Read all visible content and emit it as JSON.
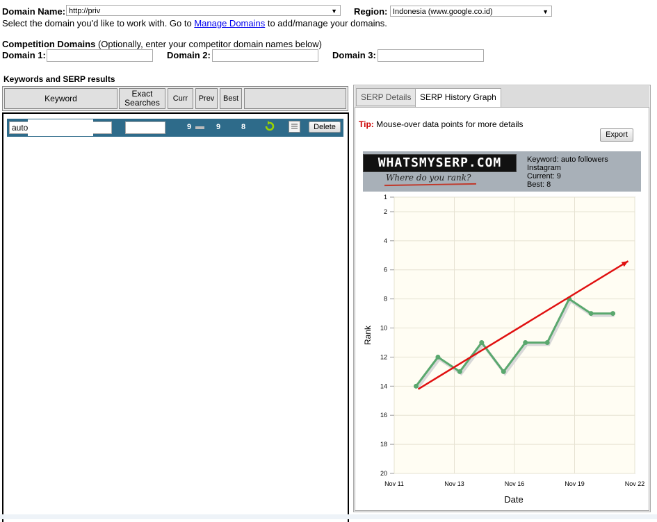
{
  "header": {
    "domain_label": "Domain Name:",
    "domain_value": "http://priv",
    "region_label": "Region:",
    "region_value": "Indonesia (www.google.co.id)",
    "instruction_before": "Select the domain you'd like to work with. Go to ",
    "instruction_link": "Manage Domains",
    "instruction_after": " to add/manage your domains."
  },
  "competition": {
    "title": "Competition Domains",
    "note": " (Optionally, enter your competitor domain names below)",
    "domain1_label": "Domain 1:",
    "domain2_label": "Domain 2:",
    "domain3_label": "Domain 3:"
  },
  "keywords": {
    "section_title": "Keywords and SERP results",
    "columns": {
      "keyword": "Keyword",
      "exact_line1": "Exact",
      "exact_line2": "Searches",
      "curr": "Curr",
      "prev": "Prev",
      "best": "Best"
    },
    "row": {
      "keyword_value": "auto",
      "curr": "9",
      "prev": "9",
      "best": "8",
      "delete_label": "Delete"
    }
  },
  "serp_panel": {
    "tabs": [
      "SERP Details",
      "SERP History Graph"
    ],
    "active_tab": "SERP History Graph",
    "tip_label": "Tip:",
    "tip_text": " Mouse-over data points for more details",
    "export_label": "Export",
    "logo_text": "WHATSMYSERP.COM",
    "logo_tagline": "Where do you rank?",
    "info": {
      "keyword_line1": "Keyword: auto followers",
      "keyword_line2": "Instagram",
      "current": "Current: 9",
      "best": "Best: 8"
    }
  },
  "colors": {
    "row_bg": "#2e6b8a",
    "series": "#5aa86e",
    "trend_arrow": "#e01010",
    "tip_red": "#cc0000",
    "plot_bg": "#fffdf3"
  },
  "chart_data": {
    "type": "line",
    "xlabel": "Date",
    "ylabel": "Rank",
    "y_reversed": true,
    "ylim": [
      1,
      20
    ],
    "y_ticks": [
      1,
      2,
      4,
      6,
      8,
      10,
      12,
      14,
      16,
      18,
      20
    ],
    "x_ticks": [
      "Nov 11",
      "Nov 13",
      "Nov 16",
      "Nov 19",
      "Nov 22"
    ],
    "x_range_days": [
      0,
      11
    ],
    "x_tick_days": [
      0,
      2.75,
      5.5,
      8.25,
      11
    ],
    "grid": true,
    "series": [
      {
        "points": [
          {
            "x_day": 1.0,
            "rank": 14
          },
          {
            "x_day": 2.0,
            "rank": 12
          },
          {
            "x_day": 3.0,
            "rank": 13
          },
          {
            "x_day": 4.0,
            "rank": 11
          },
          {
            "x_day": 5.0,
            "rank": 13
          },
          {
            "x_day": 6.0,
            "rank": 11
          },
          {
            "x_day": 7.0,
            "rank": 11
          },
          {
            "x_day": 8.0,
            "rank": 8
          },
          {
            "x_day": 9.0,
            "rank": 9
          },
          {
            "x_day": 10.0,
            "rank": 9
          }
        ]
      }
    ]
  }
}
